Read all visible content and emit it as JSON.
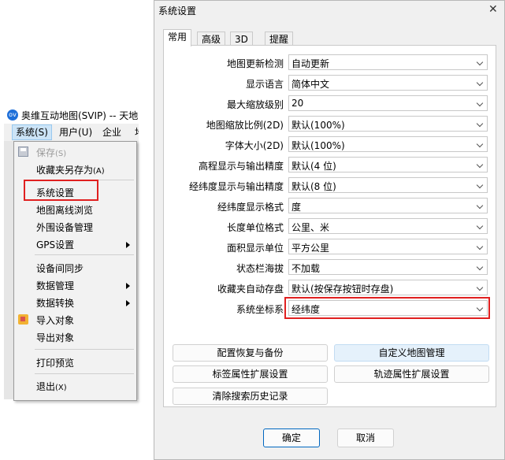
{
  "app": {
    "title": "奥维互动地图(SVIP) -- 天地图",
    "menubar": [
      "系统(S)",
      "用户(U)",
      "企业",
      "地"
    ],
    "logo_text": "ov"
  },
  "system_menu": {
    "items": [
      {
        "label": "保存",
        "key": "(S)",
        "disabled": true,
        "icon": "save-icon"
      },
      {
        "label": "收藏夹另存为",
        "key": "(A)"
      },
      {
        "label": "系统设置"
      },
      {
        "label": "地图离线浏览"
      },
      {
        "label": "外围设备管理"
      },
      {
        "label": "GPS设置",
        "submenu": true
      },
      {
        "label": "设备间同步"
      },
      {
        "label": "数据管理",
        "submenu": true
      },
      {
        "label": "数据转换",
        "submenu": true
      },
      {
        "label": "导入对象",
        "icon": "import-icon"
      },
      {
        "label": "导出对象"
      },
      {
        "label": "打印预览"
      },
      {
        "label": "退出",
        "key": "(X)"
      }
    ]
  },
  "dialog": {
    "title": "系统设置",
    "close": "✕",
    "tabs": [
      "常用",
      "高级",
      "3D",
      "提醒"
    ],
    "settings": [
      {
        "label": "地图更新检测",
        "value": "自动更新"
      },
      {
        "label": "显示语言",
        "value": "简体中文"
      },
      {
        "label": "最大缩放级别",
        "value": "20"
      },
      {
        "label": "地图缩放比例(2D)",
        "value": "默认(100%)"
      },
      {
        "label": "字体大小(2D)",
        "value": "默认(100%)"
      },
      {
        "label": "高程显示与输出精度",
        "value": "默认(4 位)"
      },
      {
        "label": "经纬度显示与输出精度",
        "value": "默认(8 位)"
      },
      {
        "label": "经纬度显示格式",
        "value": "度"
      },
      {
        "label": "长度单位格式",
        "value": "公里、米"
      },
      {
        "label": "面积显示单位",
        "value": "平方公里"
      },
      {
        "label": "状态栏海拔",
        "value": "不加载"
      },
      {
        "label": "收藏夹自动存盘",
        "value": "默认(按保存按钮时存盘)"
      },
      {
        "label": "系统坐标系",
        "value": "经纬度"
      }
    ],
    "buttons": {
      "backup": "配置恢复与备份",
      "custom_map": "自定义地图管理",
      "label_ext": "标签属性扩展设置",
      "track_ext": "轨迹属性扩展设置",
      "clear_history": "清除搜索历史记录",
      "ok": "确定",
      "cancel": "取消"
    }
  },
  "colors": {
    "highlight": "#e02020",
    "primary_border": "#0067c0"
  }
}
